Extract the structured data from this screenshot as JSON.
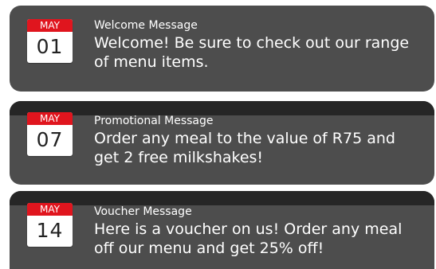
{
  "messages": [
    {
      "month": "MAY",
      "day": "01",
      "title": "Welcome Message",
      "body": "Welcome! Be sure to check out our range of menu items."
    },
    {
      "month": "MAY",
      "day": "07",
      "title": "Promotional Message",
      "body": "Order any meal to the value of R75 and get 2 free milkshakes!"
    },
    {
      "month": "MAY",
      "day": "14",
      "title": "Voucher Message",
      "body": "Here is a voucher on us! Order any meal off our menu and get 25% off!"
    }
  ],
  "colors": {
    "card_bg": "#4d4d4d",
    "card_top": "#262626",
    "month_bg": "#e0151e",
    "text": "#ffffff"
  }
}
